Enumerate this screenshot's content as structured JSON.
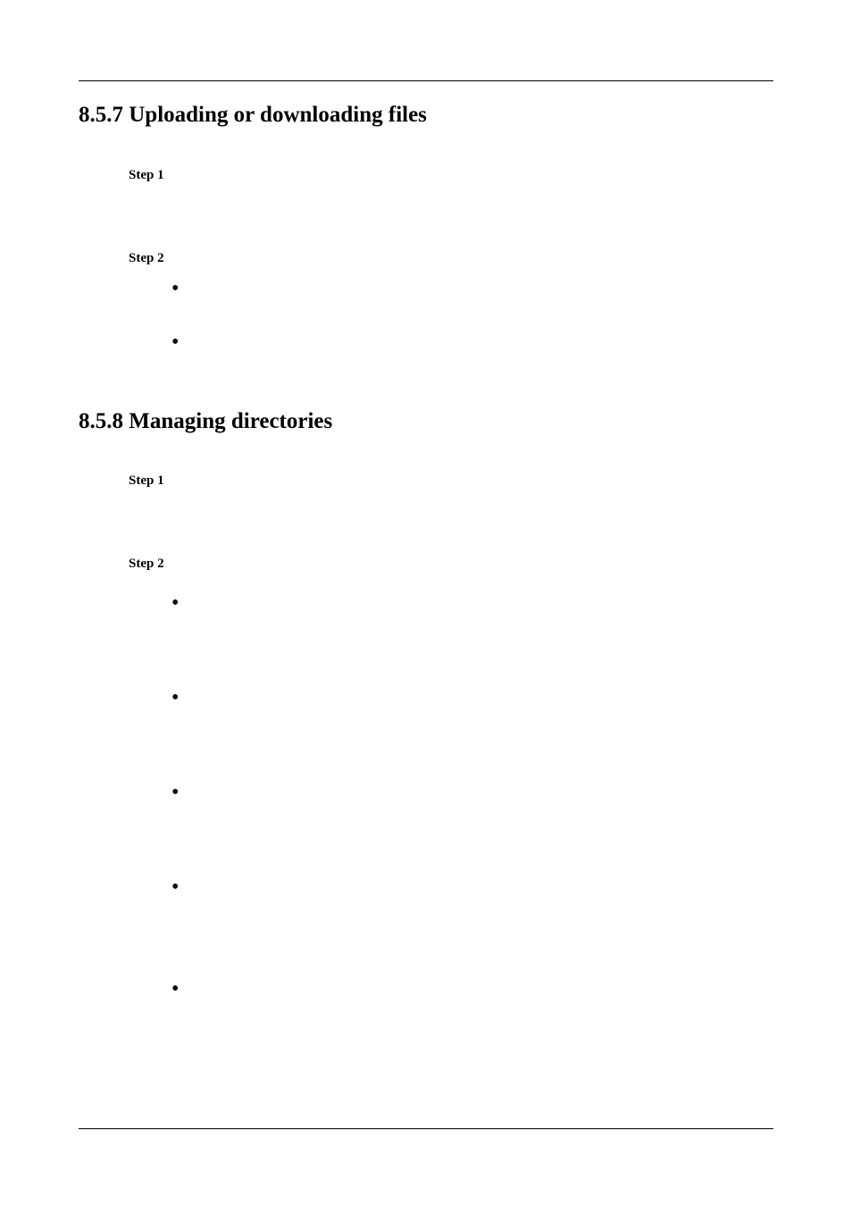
{
  "sections": [
    {
      "number": "8.5.7",
      "title": "Uploading or downloading files",
      "steps": [
        {
          "label": "Step 1",
          "bullets": []
        },
        {
          "label": "Step 2",
          "bullets": [
            "",
            ""
          ]
        }
      ]
    },
    {
      "number": "8.5.8",
      "title": "Managing directories",
      "steps": [
        {
          "label": "Step 1",
          "bullets": []
        },
        {
          "label": "Step 2",
          "bullets": [
            "",
            "",
            "",
            "",
            ""
          ]
        }
      ]
    }
  ]
}
